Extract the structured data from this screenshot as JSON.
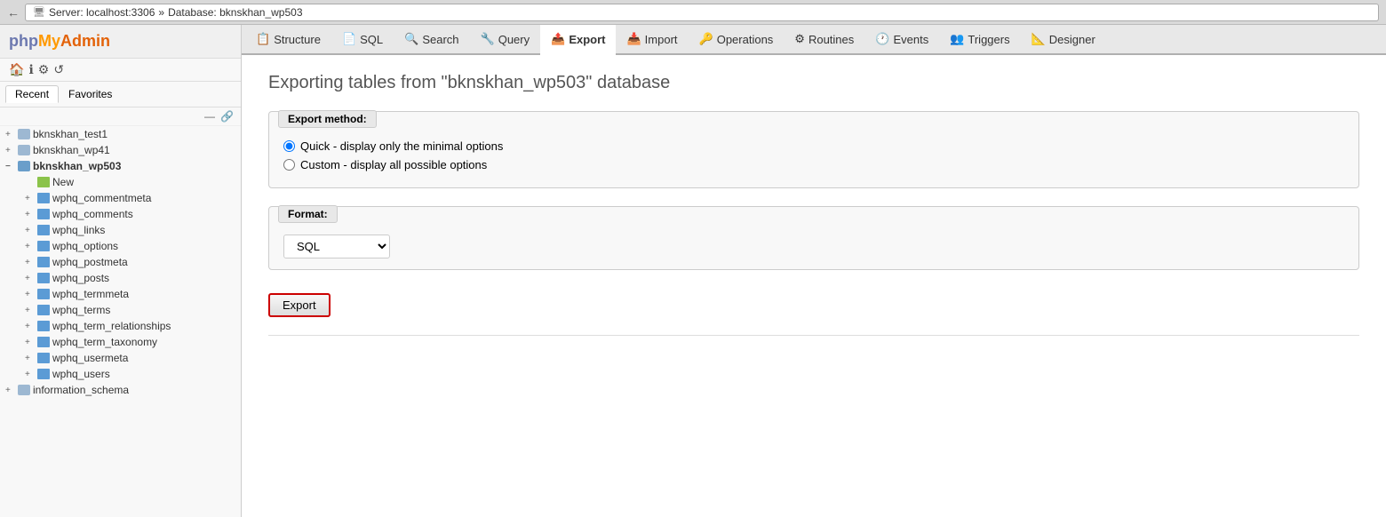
{
  "browser": {
    "back_label": "←",
    "server_label": "Server: localhost:3306",
    "database_label": "Database: bknskhan_wp503"
  },
  "sidebar": {
    "logo": {
      "php": "php",
      "my": "My",
      "admin": "Admin"
    },
    "icons": [
      "🏠",
      "ℹ",
      "⚙",
      "↺"
    ],
    "tabs": [
      "Recent",
      "Favorites"
    ],
    "collapse_icons": [
      "—",
      "🔗"
    ],
    "databases": [
      {
        "id": "bknskhan_test1",
        "label": "bknskhan_test1",
        "expanded": false
      },
      {
        "id": "bknskhan_wp41",
        "label": "bknskhan_wp41",
        "expanded": false
      },
      {
        "id": "bknskhan_wp503",
        "label": "bknskhan_wp503",
        "expanded": true,
        "children": [
          {
            "id": "new",
            "label": "New",
            "type": "new"
          },
          {
            "id": "wphq_commentmeta",
            "label": "wphq_commentmeta",
            "type": "table"
          },
          {
            "id": "wphq_comments",
            "label": "wphq_comments",
            "type": "table"
          },
          {
            "id": "wphq_links",
            "label": "wphq_links",
            "type": "table"
          },
          {
            "id": "wphq_options",
            "label": "wphq_options",
            "type": "table"
          },
          {
            "id": "wphq_postmeta",
            "label": "wphq_postmeta",
            "type": "table"
          },
          {
            "id": "wphq_posts",
            "label": "wphq_posts",
            "type": "table"
          },
          {
            "id": "wphq_termmeta",
            "label": "wphq_termmeta",
            "type": "table"
          },
          {
            "id": "wphq_terms",
            "label": "wphq_terms",
            "type": "table"
          },
          {
            "id": "wphq_term_relationships",
            "label": "wphq_term_relationships",
            "type": "table"
          },
          {
            "id": "wphq_term_taxonomy",
            "label": "wphq_term_taxonomy",
            "type": "table"
          },
          {
            "id": "wphq_usermeta",
            "label": "wphq_usermeta",
            "type": "table"
          },
          {
            "id": "wphq_users",
            "label": "wphq_users",
            "type": "table"
          }
        ]
      },
      {
        "id": "information_schema",
        "label": "information_schema",
        "expanded": false
      }
    ]
  },
  "tabs": [
    {
      "id": "structure",
      "label": "Structure",
      "icon": "📋"
    },
    {
      "id": "sql",
      "label": "SQL",
      "icon": "📄"
    },
    {
      "id": "search",
      "label": "Search",
      "icon": "🔍"
    },
    {
      "id": "query",
      "label": "Query",
      "icon": "🔧"
    },
    {
      "id": "export",
      "label": "Export",
      "icon": "📤",
      "active": true
    },
    {
      "id": "import",
      "label": "Import",
      "icon": "📥"
    },
    {
      "id": "operations",
      "label": "Operations",
      "icon": "🔑"
    },
    {
      "id": "routines",
      "label": "Routines",
      "icon": "⚙"
    },
    {
      "id": "events",
      "label": "Events",
      "icon": "🕐"
    },
    {
      "id": "triggers",
      "label": "Triggers",
      "icon": "👥"
    },
    {
      "id": "designer",
      "label": "Designer",
      "icon": "📐"
    }
  ],
  "page": {
    "title": "Exporting tables from \"bknskhan_wp503\" database",
    "export_method": {
      "legend": "Export method:",
      "options": [
        {
          "id": "quick",
          "label": "Quick - display only the minimal options",
          "checked": true
        },
        {
          "id": "custom",
          "label": "Custom - display all possible options",
          "checked": false
        }
      ]
    },
    "format": {
      "legend": "Format:",
      "value": "SQL"
    },
    "export_button": "Export"
  }
}
